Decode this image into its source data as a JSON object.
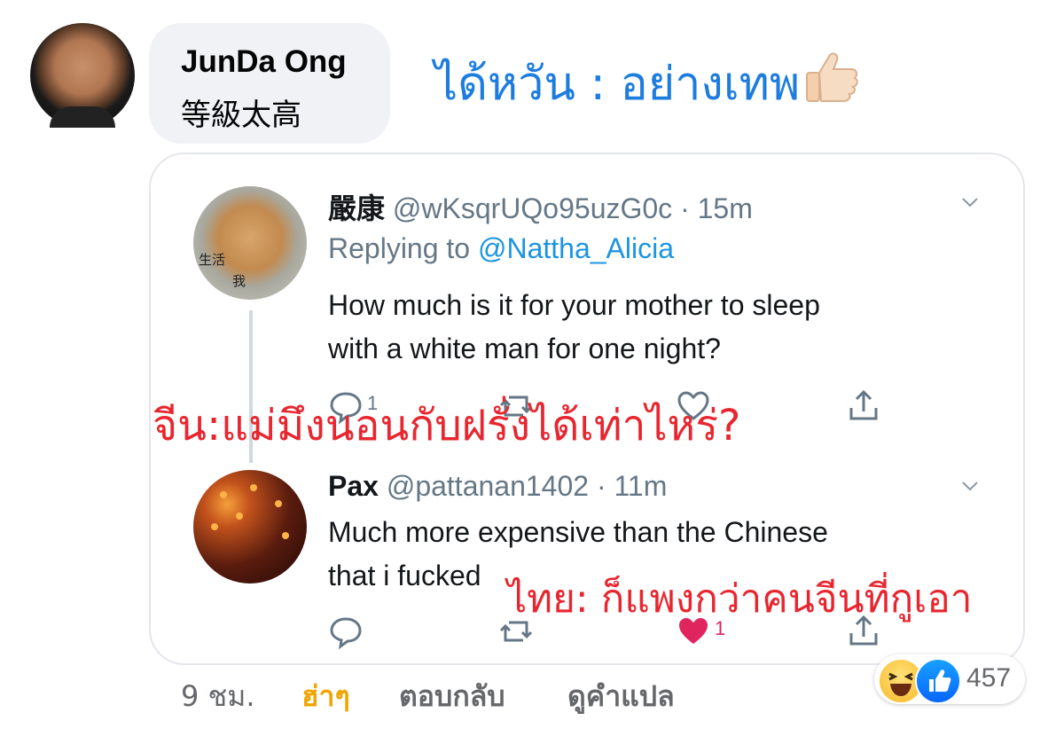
{
  "comment": {
    "author": "JunDa Ong",
    "text": "等級太高",
    "annotation": "ได้หวัน : อย่างเทพ",
    "annotation_emoji": "thumbs-up-icon"
  },
  "tweets": [
    {
      "name": "嚴康",
      "handle": "@wKsqrUQo95uzG0c",
      "time": "· 15m",
      "replying_label": "Replying to",
      "replying_handle": "@Nattha_Alicia",
      "text_line1": "How much is it for your mother to sleep",
      "text_line2": "with a white man for one night?",
      "avatar_labels": [
        "生活",
        "我"
      ],
      "actions": {
        "reply": "1",
        "retweet": "",
        "like": "",
        "share": ""
      }
    },
    {
      "name": "Pax",
      "handle": "@pattanan1402",
      "time": "· 11m",
      "text_line1": "Much more expensive than the Chinese",
      "text_line2": "that i fucked",
      "actions": {
        "reply": "",
        "retweet": "",
        "like": "1",
        "share": ""
      }
    }
  ],
  "overlays": {
    "red_1": "จีน:แม่มึงนอนกับฝรั่งได้เท่าไหร่?",
    "red_2": "ไทย: ก็แพงกว่าคนจีนที่กูเอา"
  },
  "footer": {
    "time": "9 ชม.",
    "reaction": "ฮ่าๆ",
    "reply": "ตอบกลับ",
    "translate": "ดูคำแปล"
  },
  "reactions": {
    "count": "457",
    "icons": [
      "haha-icon",
      "like-icon"
    ]
  },
  "colors": {
    "annotation_blue": "#1d7ddf",
    "overlay_red": "#e8262f",
    "twitter_link": "#1b95e0",
    "like_pink": "#e0245e",
    "haha_text": "#f0a500"
  }
}
